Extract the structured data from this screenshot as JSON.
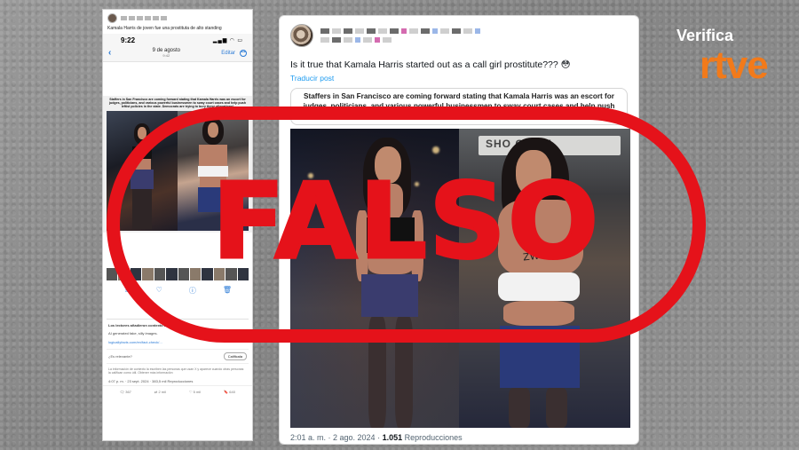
{
  "phone": {
    "caption": "Kamala Harris de joven fue una prostituta de alto standing",
    "time": "9:22",
    "nav_date": "9 de agosto",
    "nav_time": "9:42",
    "edit_label": "Editar",
    "image_text": "Staffers in San Francisco are coming forward stating that Kamala Harris was an escort for judges, politicians, and various powerful businessmen to sway court cases and help push leftist policies in the state. Democrats are trying to bury these allegations!",
    "note_header": "Los lectores añadieron contexto a esta imagen",
    "note_body": "AI generated fake, silly images.",
    "note_link": "logicallyfacts.com/en/fact-check/...",
    "note_question": "¿Es relevante?",
    "note_rate": "Calificala",
    "note_footer": "La información de contexto la escriben las personas que usan X y aparece cuando otras personas la califican como útil. Obtener más información",
    "meta": "4:07 p. m. · 23 sept. 2024 · 383,5 mil Reproducciones",
    "bottom_actions": [
      "367",
      "2 mil",
      "5 mil",
      "640"
    ]
  },
  "tweet": {
    "text": "Is it true that Kamala Harris started out as a call girl prostitute??? 😳",
    "translate": "Traducir post",
    "quote": "Staffers in San Francisco are coming forward stating that Kamala Harris was an escort for judges, politicians, and various powerful businessmen to sway court cases and help push leftist policies in the state. Democrats are trying to bury these allegations!",
    "sign_text": "SHO CRALL",
    "tattoo_text": "ZWEGOT",
    "timestamp": "2:01 a. m. · 2 ago. 2024 · ",
    "views": "1.051",
    "views_label": " Reproducciones"
  },
  "stamp": {
    "text": "FALSO",
    "color": "#e5121a"
  },
  "logo": {
    "top": "Verifica",
    "main": "rtve",
    "color": "#f27a1a"
  },
  "icons": [
    "back-chevron-icon",
    "more-icon",
    "reply-icon",
    "like-icon",
    "share-icon"
  ]
}
